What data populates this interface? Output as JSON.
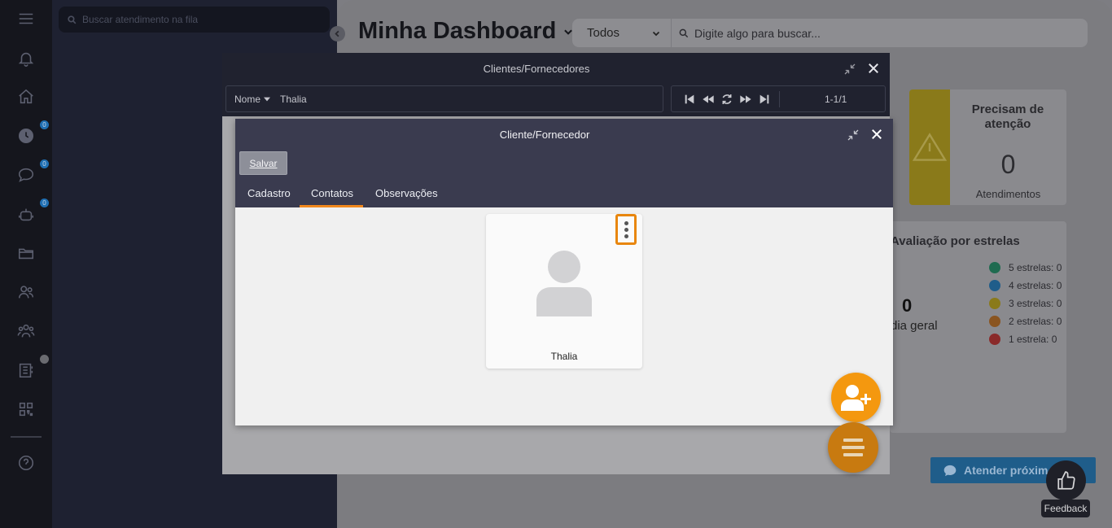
{
  "queue": {
    "search_placeholder": "Buscar atendimento na fila"
  },
  "rail": {
    "items": [
      {
        "icon": "menu-icon"
      },
      {
        "icon": "bell-icon"
      },
      {
        "icon": "home-icon"
      },
      {
        "icon": "clock-icon",
        "badge": "0"
      },
      {
        "icon": "chat-icon",
        "badge": "0"
      },
      {
        "icon": "robot-icon",
        "badge": "0"
      },
      {
        "icon": "folder-icon"
      },
      {
        "icon": "users-icon"
      },
      {
        "icon": "group-icon"
      },
      {
        "icon": "contacts-book-icon"
      },
      {
        "icon": "qr-code-icon"
      },
      {
        "icon": "help-icon"
      }
    ]
  },
  "dashboard": {
    "title": "Minha Dashboard",
    "filter_selected": "Todos",
    "search_placeholder": "Digite algo para buscar...",
    "attention": {
      "title": "Precisam de atenção",
      "count": "0",
      "sub": "Atendimentos"
    },
    "stars": {
      "title": "Avaliação por estrelas",
      "avg_value": "0",
      "avg_label": "dia geral",
      "items": [
        {
          "label": "5 estrelas: 0",
          "color": "#1f6b50"
        },
        {
          "label": "4 estrelas: 0",
          "color": "#1f5d8a"
        },
        {
          "label": "3 estrelas: 0",
          "color": "#8a7a1a"
        },
        {
          "label": "2 estrelas: 0",
          "color": "#8a5520"
        },
        {
          "label": "1 estrela: 0",
          "color": "#8a2a2a"
        }
      ]
    },
    "attend_button": "Atender próxim",
    "feedback_label": "Feedback"
  },
  "outer_modal": {
    "title": "Clientes/Fornecedores",
    "search_field": "Nome",
    "search_value": "Thalia",
    "pager_count": "1-1/1"
  },
  "inner_modal": {
    "title": "Cliente/Fornecedor",
    "save_label": "Salvar",
    "tabs": [
      "Cadastro",
      "Contatos",
      "Observações"
    ],
    "active_tab": "Contatos",
    "contact": {
      "name": "Thalia"
    }
  },
  "colors": {
    "accent": "#f0871c",
    "fab_add": "#f4980f",
    "header_dark": "#20222f",
    "header_inner": "#3a3b4f"
  }
}
